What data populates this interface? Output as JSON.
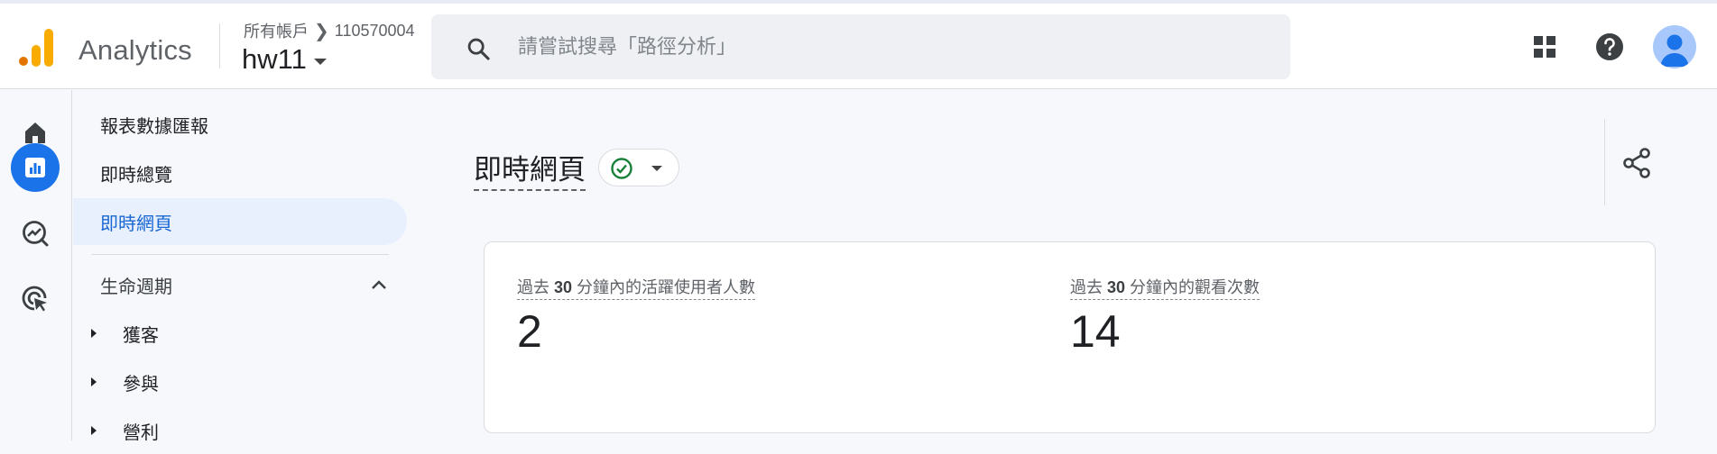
{
  "app": {
    "name": "Analytics"
  },
  "header": {
    "breadcrumb": [
      "所有帳戶",
      "110570004"
    ],
    "property": "hw11",
    "search_placeholder": "請嘗試搜尋「路徑分析」"
  },
  "subnav": {
    "items": [
      {
        "label": "報表數據匯報",
        "active": false
      },
      {
        "label": "即時總覽",
        "active": false
      },
      {
        "label": "即時網頁",
        "active": true
      }
    ],
    "section": {
      "label": "生命週期",
      "expanded": true
    },
    "tree": [
      "獲客",
      "參與",
      "營利"
    ]
  },
  "main": {
    "title": "即時網頁",
    "status": "ok",
    "metrics": [
      {
        "label_pre": "過去 ",
        "label_num": "30",
        "label_post": " 分鐘內的活躍使用者人數",
        "value": "2"
      },
      {
        "label_pre": "過去 ",
        "label_num": "30",
        "label_post": " 分鐘內的觀看次數",
        "value": "14"
      }
    ]
  },
  "colors": {
    "accent": "#1a73e8",
    "active_bg": "#e8f0fe",
    "active_text": "#1967d2",
    "logo_orange": "#f9ab00",
    "logo_dark": "#e37400",
    "success": "#188038"
  }
}
